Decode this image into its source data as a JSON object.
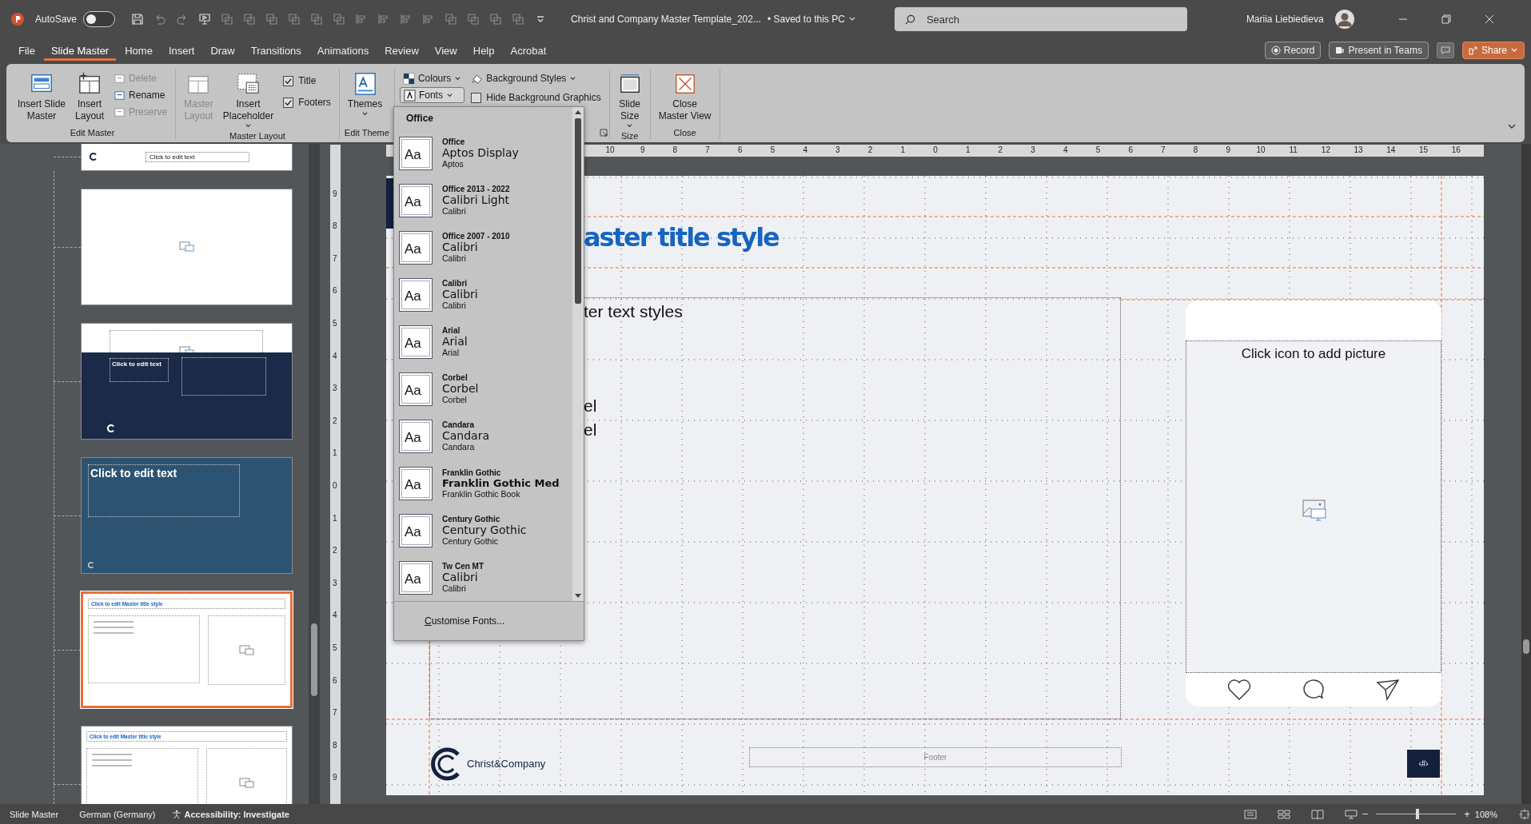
{
  "title_bar": {
    "autosave_label": "AutoSave",
    "autosave_on": false,
    "document_title": "Christ and Company Master Template_202...",
    "save_status": "• Saved to this PC",
    "search_placeholder": "Search",
    "user_name": "Mariia Liebiedieva"
  },
  "menu_tabs": [
    {
      "label": "File",
      "selected": false
    },
    {
      "label": "Slide Master",
      "selected": true
    },
    {
      "label": "Home",
      "selected": false
    },
    {
      "label": "Insert",
      "selected": false
    },
    {
      "label": "Draw",
      "selected": false
    },
    {
      "label": "Transitions",
      "selected": false
    },
    {
      "label": "Animations",
      "selected": false
    },
    {
      "label": "Review",
      "selected": false
    },
    {
      "label": "View",
      "selected": false
    },
    {
      "label": "Help",
      "selected": false
    },
    {
      "label": "Acrobat",
      "selected": false
    }
  ],
  "menu_actions": [
    {
      "label": "Record",
      "kind": "outline"
    },
    {
      "label": "Present in Teams",
      "kind": "outline"
    },
    {
      "label": "Share",
      "kind": "accent"
    }
  ],
  "ribbon_groups": [
    {
      "label": "Edit Master",
      "has_launcher": false,
      "columns": [
        [
          {
            "kind": "large",
            "label": "Insert Slide\nMaster",
            "disabled": false,
            "has_menu": false
          }
        ],
        [
          {
            "kind": "large",
            "label": "Insert\nLayout",
            "disabled": false,
            "has_menu": false
          }
        ],
        [
          {
            "kind": "small",
            "label": "Delete",
            "disabled": true,
            "has_menu": false,
            "open": false
          },
          {
            "kind": "small",
            "label": "Rename",
            "disabled": false,
            "has_menu": false,
            "open": false
          },
          {
            "kind": "small",
            "label": "Preserve",
            "disabled": true,
            "has_menu": false,
            "open": false
          }
        ]
      ]
    },
    {
      "label": "Master Layout",
      "has_launcher": false,
      "columns": [
        [
          {
            "kind": "large",
            "label": "Master\nLayout",
            "disabled": true,
            "has_menu": false
          }
        ],
        [
          {
            "kind": "large",
            "label": "Insert\nPlaceholder",
            "disabled": false,
            "has_menu": true
          }
        ],
        [
          {
            "kind": "check",
            "label": "Title",
            "checked": true
          },
          {
            "kind": "check",
            "label": "Footers",
            "checked": true
          }
        ]
      ]
    },
    {
      "label": "Edit Theme",
      "has_launcher": false,
      "columns": [
        [
          {
            "kind": "large",
            "label": "Themes",
            "disabled": false,
            "has_menu": true
          }
        ]
      ]
    },
    {
      "has_launcher": true,
      "columns": [
        [
          {
            "kind": "small",
            "label": "Colours",
            "disabled": false,
            "has_menu": true,
            "open": false
          },
          {
            "kind": "small",
            "label": "Fonts",
            "disabled": false,
            "has_menu": true,
            "open": true
          }
        ],
        [
          {
            "kind": "small",
            "label": "Background Styles",
            "disabled": false,
            "has_menu": true,
            "open": false
          },
          {
            "kind": "check",
            "label": "Hide Background Graphics",
            "checked": false
          }
        ]
      ]
    },
    {
      "label": "Size",
      "has_launcher": false,
      "columns": [
        [
          {
            "kind": "large",
            "label": "Slide\nSize",
            "disabled": false,
            "has_menu": true
          }
        ]
      ]
    },
    {
      "label": "Close",
      "has_launcher": false,
      "columns": [
        [
          {
            "kind": "large",
            "label": "Close\nMaster View",
            "disabled": false,
            "has_menu": false
          }
        ]
      ]
    }
  ],
  "font_menu": {
    "header": "Office",
    "footer": "Customise Fonts...",
    "items": [
      {
        "name": "Office",
        "heading": "Aptos Display",
        "body": "Aptos",
        "preview": "Aa"
      },
      {
        "name": "Office 2013 - 2022",
        "heading": "Calibri Light",
        "body": "Calibri",
        "preview": "Aa"
      },
      {
        "name": "Office 2007 - 2010",
        "heading": "Calibri",
        "body": "Calibri",
        "preview": "Aa"
      },
      {
        "name": "Calibri",
        "heading": "Calibri",
        "body": "Calibri",
        "preview": "Aa"
      },
      {
        "name": "Arial",
        "heading": "Arial",
        "body": "Arial",
        "preview": "Aa"
      },
      {
        "name": "Corbel",
        "heading": "Corbel",
        "body": "Corbel",
        "preview": "Aa"
      },
      {
        "name": "Candara",
        "heading": "Candara",
        "body": "Candara",
        "preview": "Aa"
      },
      {
        "name": "Franklin Gothic",
        "heading": "Franklin Gothic Med",
        "body": "Franklin Gothic Book",
        "preview": "Aa"
      },
      {
        "name": "Century Gothic",
        "heading": "Century Gothic",
        "body": "Century Gothic",
        "preview": "Aa"
      },
      {
        "name": "Tw Cen MT",
        "heading": "Calibri",
        "body": "Calibri",
        "preview": "Aa"
      }
    ]
  },
  "thumbnails": [
    {
      "kind": "footer_strip",
      "text": "Click to edit text",
      "selected": false
    },
    {
      "kind": "picture",
      "selected": false
    },
    {
      "kind": "navy_split",
      "text": "Click to edit text",
      "selected": false
    },
    {
      "kind": "blue_text",
      "text": "Click to edit text",
      "selected": false
    },
    {
      "kind": "master",
      "text": "Click to edit Master title style",
      "selected": true
    },
    {
      "kind": "master_partial",
      "text": "Click to edit Master title style",
      "selected": false
    }
  ],
  "ruler_h": [
    "10",
    "9",
    "8",
    "7",
    "6",
    "5",
    "4",
    "3",
    "2",
    "1",
    "0",
    "1",
    "2",
    "3",
    "4",
    "5",
    "6",
    "7",
    "8",
    "9",
    "10",
    "11",
    "12",
    "13",
    "14",
    "15",
    "16"
  ],
  "ruler_v": [
    "9",
    "8",
    "7",
    "6",
    "5",
    "4",
    "3",
    "2",
    "1",
    "0",
    "1",
    "2",
    "3",
    "4",
    "5",
    "6",
    "7",
    "8",
    "9"
  ],
  "slide": {
    "title_fragment": "aster title style",
    "body_fragments": [
      "ter text styles",
      "el",
      "el"
    ],
    "picture_prompt": "Click icon to add picture",
    "brand": "Christ&Company",
    "footer": "Footer",
    "page_number": "‹#›"
  },
  "status_bar": {
    "mode": "Slide Master",
    "language": "German (Germany)",
    "accessibility": "Accessibility: Investigate",
    "zoom": {
      "level": 0.52
    },
    "zoom_out_sign": "−",
    "zoom_in_sign": "+",
    "zoom_label": "108%"
  }
}
